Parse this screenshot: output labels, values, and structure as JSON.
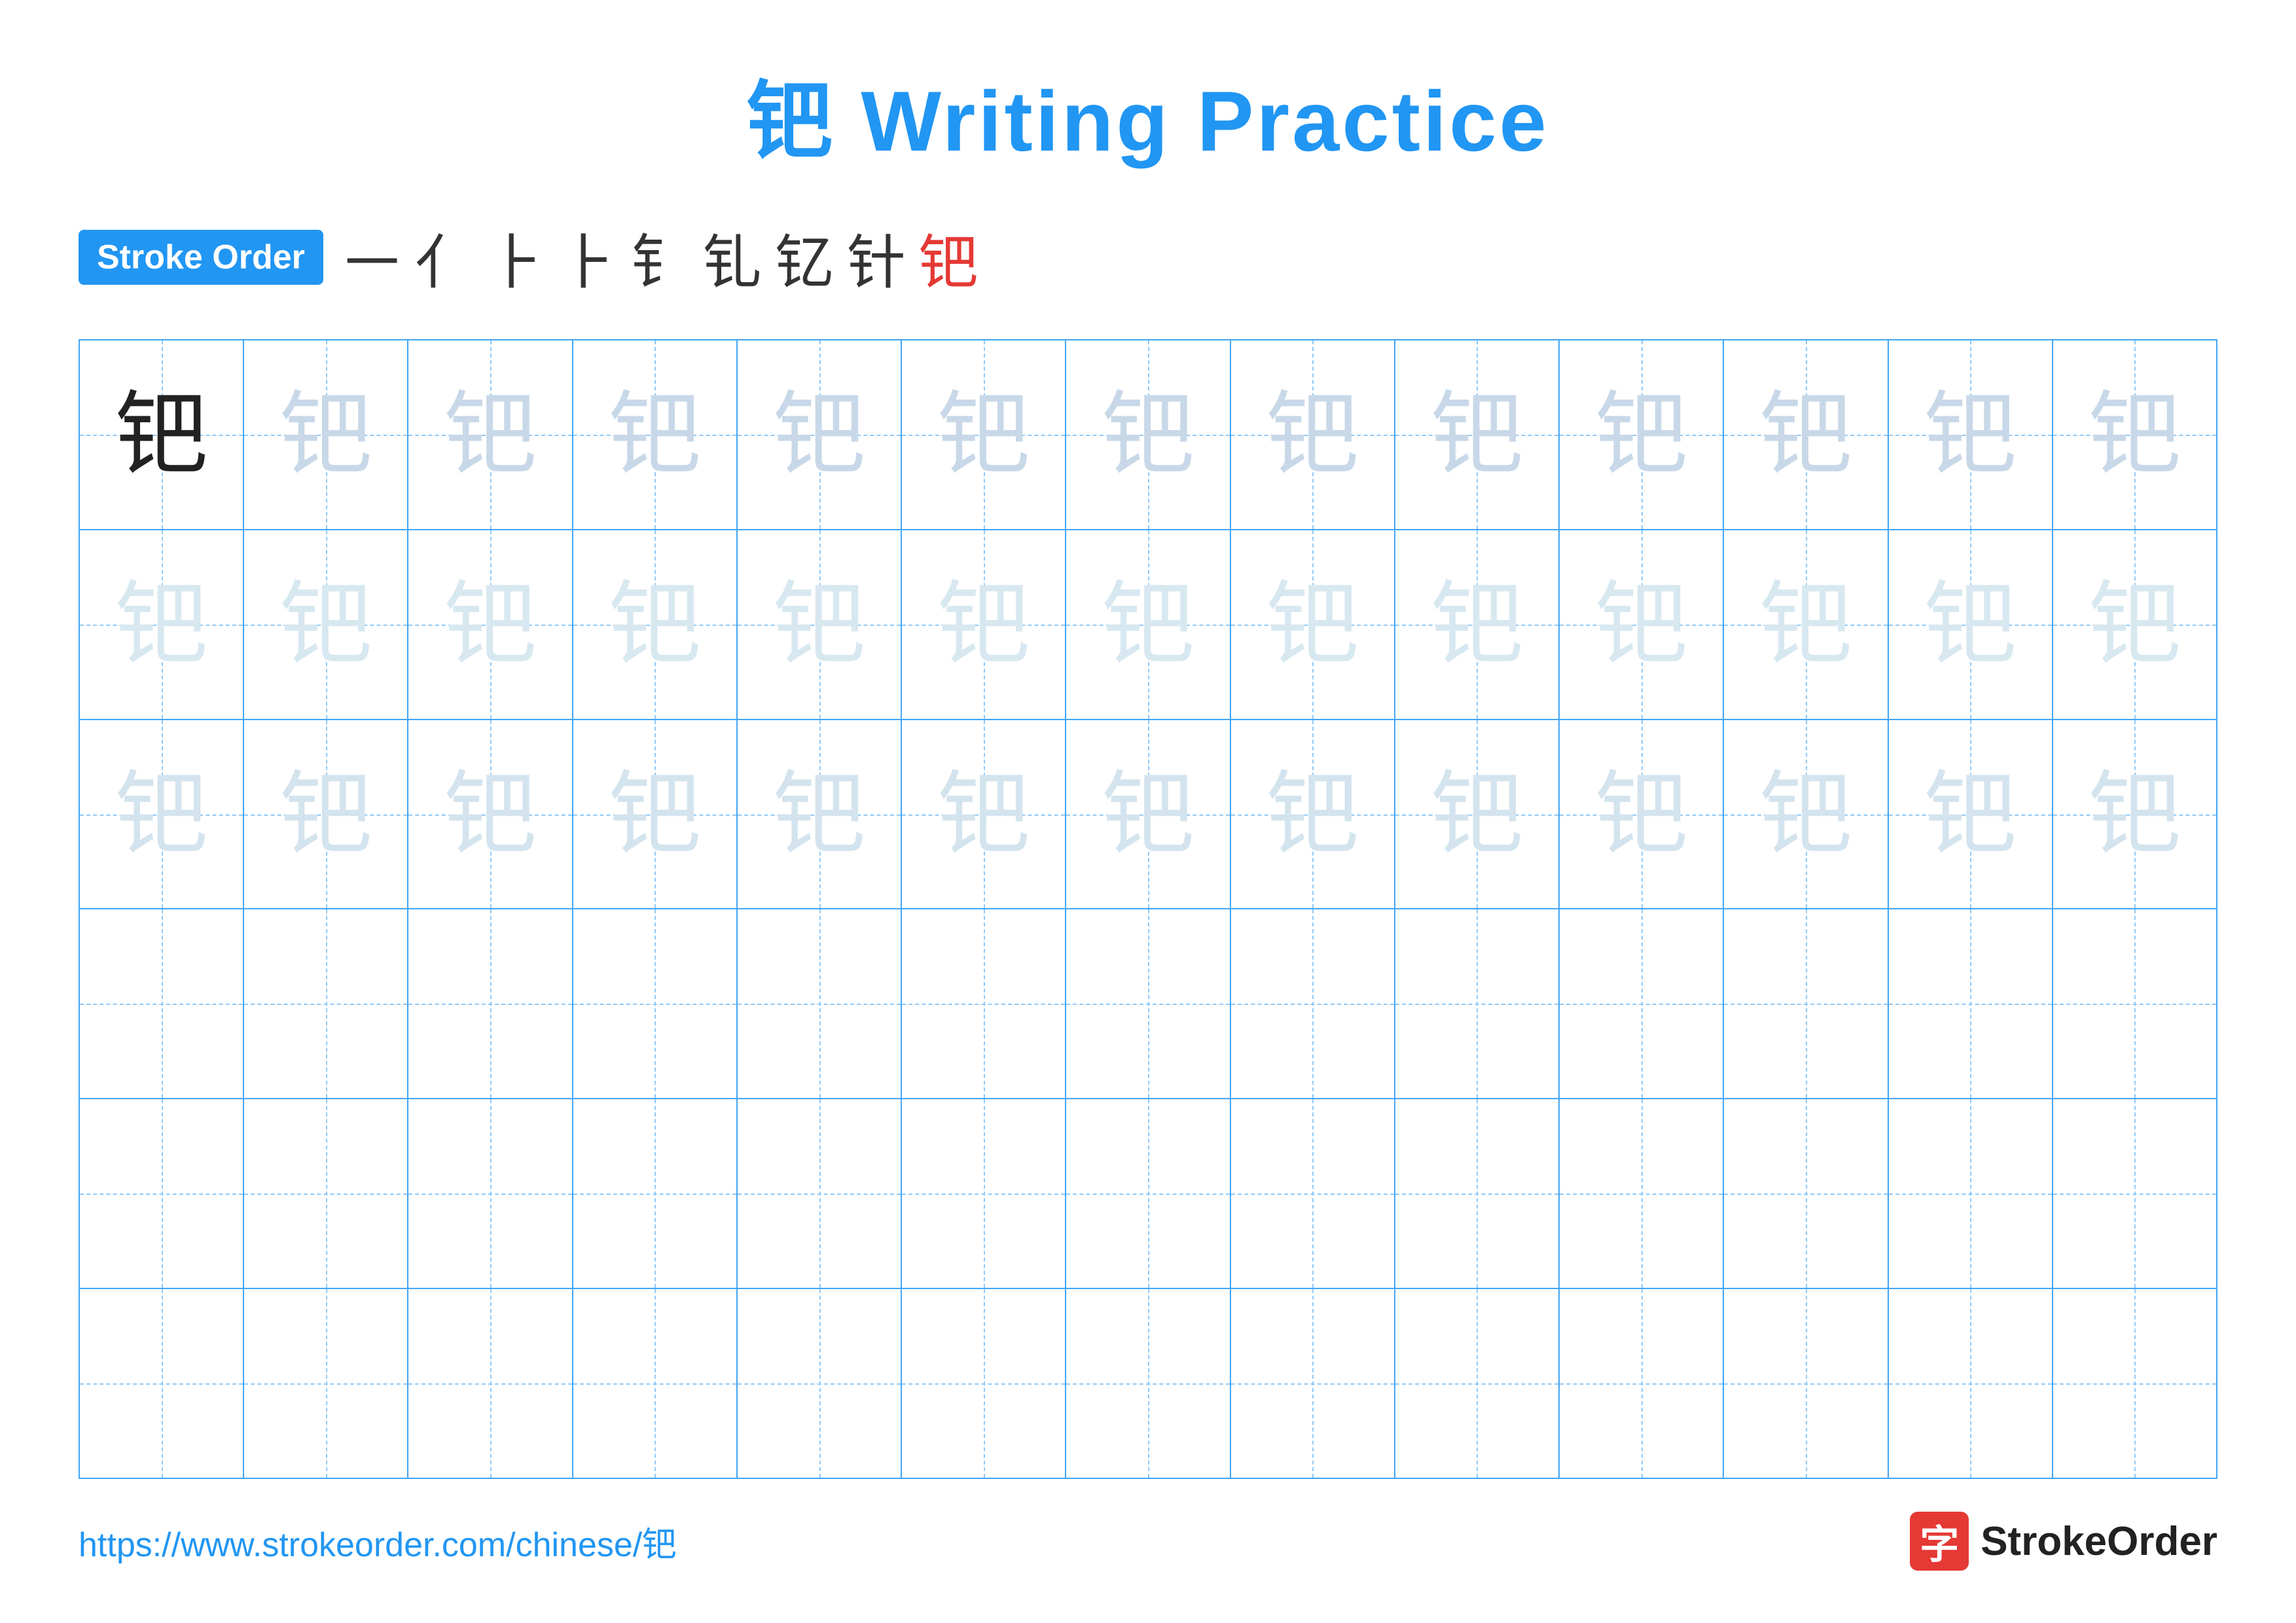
{
  "title": "钯 Writing Practice",
  "stroke_order_label": "Stroke Order",
  "stroke_sequence": [
    "㇐",
    "亻",
    "⺊",
    "⺊",
    "钅",
    "钆",
    "钇",
    "针",
    "钯"
  ],
  "stroke_sequence_last_red": true,
  "character": "钯",
  "rows": [
    {
      "type": "dark_then_light",
      "dark_count": 1,
      "light_count": 12,
      "style": "light"
    },
    {
      "type": "all_light",
      "count": 13,
      "style": "lighter"
    },
    {
      "type": "all_light",
      "count": 13,
      "style": "lighter2"
    },
    {
      "type": "empty",
      "count": 13
    },
    {
      "type": "empty",
      "count": 13
    },
    {
      "type": "empty",
      "count": 13
    }
  ],
  "footer": {
    "url": "https://www.strokeorder.com/chinese/钯",
    "logo_text": "StrokeOrder",
    "logo_char": "字"
  },
  "colors": {
    "blue": "#2196F3",
    "blue_light": "#42A5F5",
    "blue_dashed": "#90CAF9",
    "red": "#e53935",
    "dark_char": "#1a1a1a",
    "light_char": "#b0c8d8",
    "lighter_char": "#c8d8e8"
  }
}
